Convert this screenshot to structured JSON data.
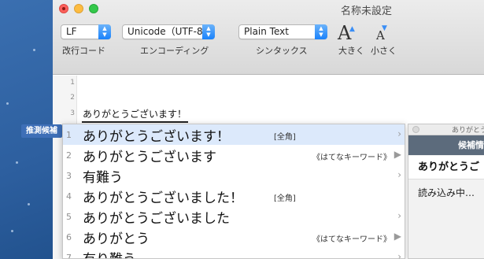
{
  "window": {
    "title": "名称未設定",
    "traffic_lights": {
      "close": "#fc605b",
      "minimize": "#fdbc40",
      "maximize": "#34c84a"
    }
  },
  "toolbar": {
    "line_ending": {
      "value": "LF",
      "label": "改行コード"
    },
    "encoding": {
      "value": "Unicode（UTF-8）",
      "label": "エンコーディング"
    },
    "syntax": {
      "value": "Plain Text",
      "label": "シンタックス"
    },
    "font_larger": {
      "label": "大きく",
      "icon": "font-larger-icon"
    },
    "font_smaller": {
      "label": "小さく",
      "icon": "font-smaller-icon"
    }
  },
  "editor": {
    "line_numbers": [
      "1",
      "2",
      "3"
    ],
    "composing_text": "ありがとうございます！"
  },
  "ime": {
    "mode_label": "推測候補",
    "selection_color": "#dce9fb",
    "candidates": [
      {
        "num": "1",
        "word": "ありがとうございます！",
        "note": "[全角]",
        "arrow": "›"
      },
      {
        "num": "2",
        "word": "ありがとうございます",
        "note": "《はてなキーワード》",
        "arrow": "▶"
      },
      {
        "num": "3",
        "word": "有難う",
        "note": "",
        "arrow": "›"
      },
      {
        "num": "4",
        "word": "ありがとうございました！",
        "note": "[全角]",
        "arrow": ""
      },
      {
        "num": "5",
        "word": "ありがとうございました",
        "note": "",
        "arrow": "›"
      },
      {
        "num": "6",
        "word": "ありがとう",
        "note": "《はてなキーワード》",
        "arrow": "▶"
      },
      {
        "num": "7",
        "word": "有り難う",
        "note": "",
        "arrow": "›"
      }
    ]
  },
  "info_panel": {
    "bar_title": "ありがとう",
    "header": "候補情",
    "word": "ありがとうご",
    "loading": "読み込み中…"
  }
}
